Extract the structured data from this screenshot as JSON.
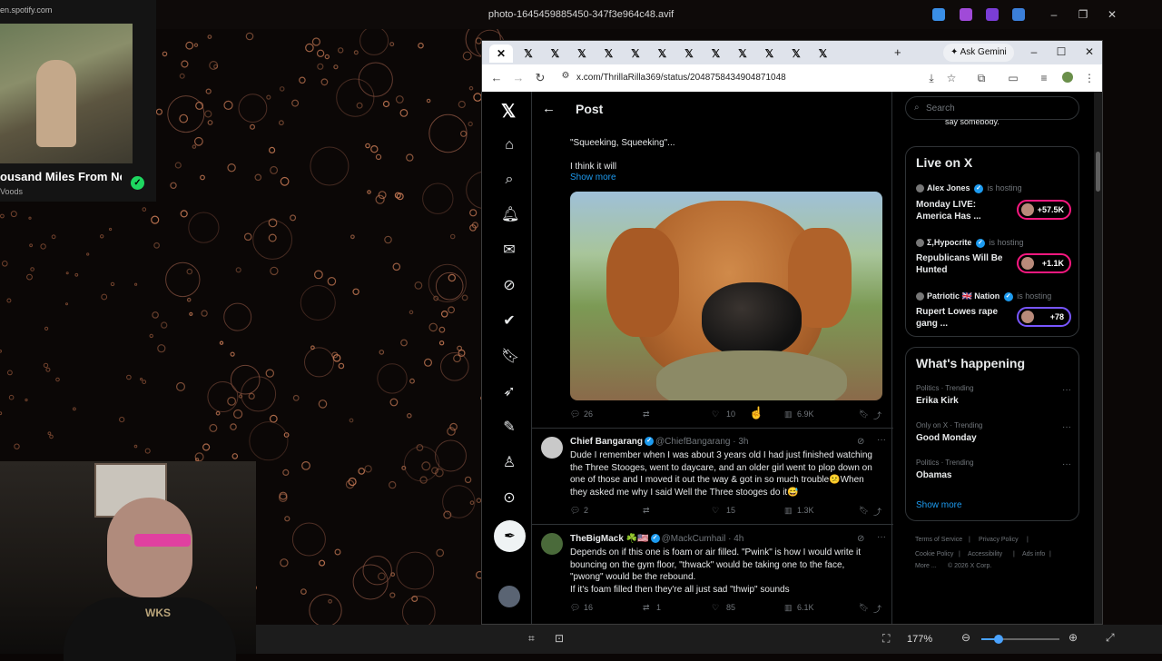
{
  "viewer": {
    "title": "photo-1645459885450-347f3e964c48.avif",
    "zoom": "177%",
    "zoom_slider_value": 0.22
  },
  "spotify": {
    "url": "en.spotify.com",
    "song_title": "ousand Miles From No",
    "artist": "Voods"
  },
  "webcam": {
    "shirt_text": "WKS"
  },
  "browser": {
    "tab_count": 13,
    "ask_gemini": "Ask Gemini",
    "url": "x.com/ThrillaRilla369/status/2048758434904871048"
  },
  "x": {
    "header_title": "Post",
    "post": {
      "text_line1": "\"Squeeking, Squeeking\"...",
      "text_line2": "I think it will",
      "show_more": "Show more",
      "replies": "26",
      "likes": "10",
      "views": "6.9K"
    },
    "replies": [
      {
        "name": "Chief Bangarang",
        "handle": "@ChiefBangarang · 3h",
        "text": [
          "Dude I remember when I was about 3 years old I had just finished watching",
          "the Three Stooges, went to daycare, and an older girl went to plop down on",
          "one of those and I moved it out the way & got in so much trouble😕When",
          "they asked me why I said Well the Three stooges do it😅"
        ],
        "replies": "2",
        "reposts": "",
        "likes": "15",
        "views": "1.3K"
      },
      {
        "name": "TheBigMack ☘️🇺🇸",
        "handle": "@MackCumhail · 4h",
        "text": [
          "Depends on if this one is foam or air filled. \"Pwink\" is how I would write it",
          "bouncing on the gym floor, \"thwack\" would be taking one to the face,",
          "\"pwong\" would be the rebound.",
          "If it's foam filled then they're all just sad \"thwip\" sounds"
        ],
        "replies": "16",
        "reposts": "1",
        "likes": "85",
        "views": "6.1K"
      }
    ],
    "search_placeholder": "Search",
    "clipped_text": "say somebody.",
    "live": {
      "title": "Live on X",
      "items": [
        {
          "host": "Alex Jones",
          "hosting": "is hosting",
          "title": "Monday LIVE: America Has ...",
          "count": "+57.5K"
        },
        {
          "host": "Σ,Hypocrite",
          "hosting": "is hosting",
          "title": "Republicans Will Be Hunted",
          "count": "+1.1K"
        },
        {
          "host": "Patriotic 🇬🇧 Nation",
          "hosting": "is hosting",
          "title": "Rupert Lowes rape gang ...",
          "count": "+78"
        }
      ]
    },
    "happening": {
      "title": "What's happening",
      "trends": [
        {
          "meta": "Politics · Trending",
          "name": "Erika Kirk"
        },
        {
          "meta": "Only on X · Trending",
          "name": "Good Monday"
        },
        {
          "meta": "Politics · Trending",
          "name": "Obamas"
        }
      ],
      "show_more": "Show more"
    },
    "footer": [
      "Terms of Service",
      "|",
      "Privacy Policy",
      "|",
      "Cookie Policy",
      "|",
      "Accessibility",
      "|",
      "Ads info",
      "|",
      "More ...",
      "© 2026 X Corp."
    ]
  }
}
